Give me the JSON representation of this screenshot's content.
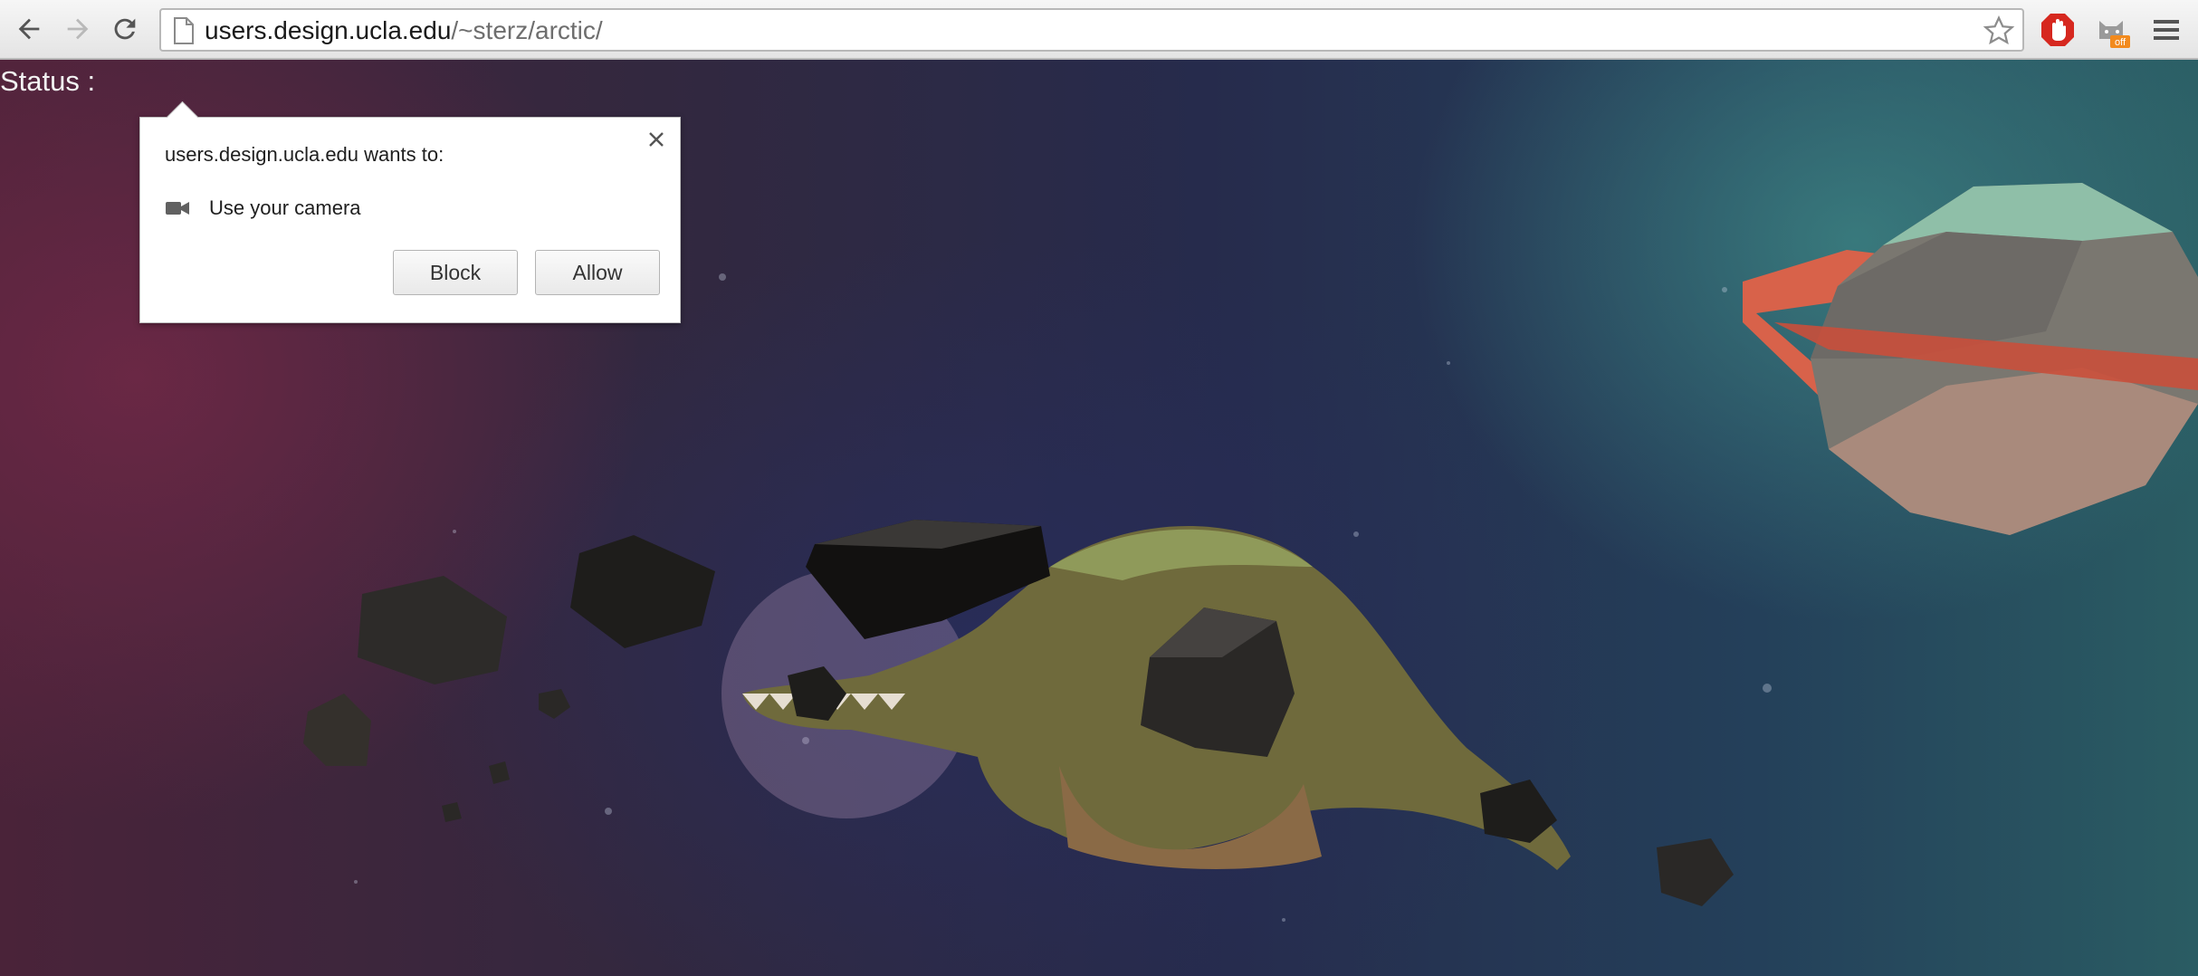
{
  "browser": {
    "url_host": "users.design.ucla.edu",
    "url_path": "/~sterz/arctic/",
    "nav_icons": [
      "back-arrow-icon",
      "forward-arrow-icon",
      "reload-icon"
    ],
    "extension_icons": [
      "adblock-stop-icon",
      "cat-extension-icon",
      "menu-icon"
    ],
    "extension_badge": "off"
  },
  "page": {
    "status_label": "Status :",
    "scene_description_icons": [
      "dinosaur-model",
      "asteroid-rocks",
      "ringed-planet",
      "star-particles"
    ]
  },
  "permission_prompt": {
    "title": "users.design.ucla.edu wants to:",
    "request_icon": "camera-icon",
    "request_text": "Use your camera",
    "block_label": "Block",
    "allow_label": "Allow",
    "close_icon": "close-icon"
  },
  "colors": {
    "planet_ring": "#d8624a",
    "dino_body": "#7a6a3a",
    "rock": "#2a2826"
  }
}
